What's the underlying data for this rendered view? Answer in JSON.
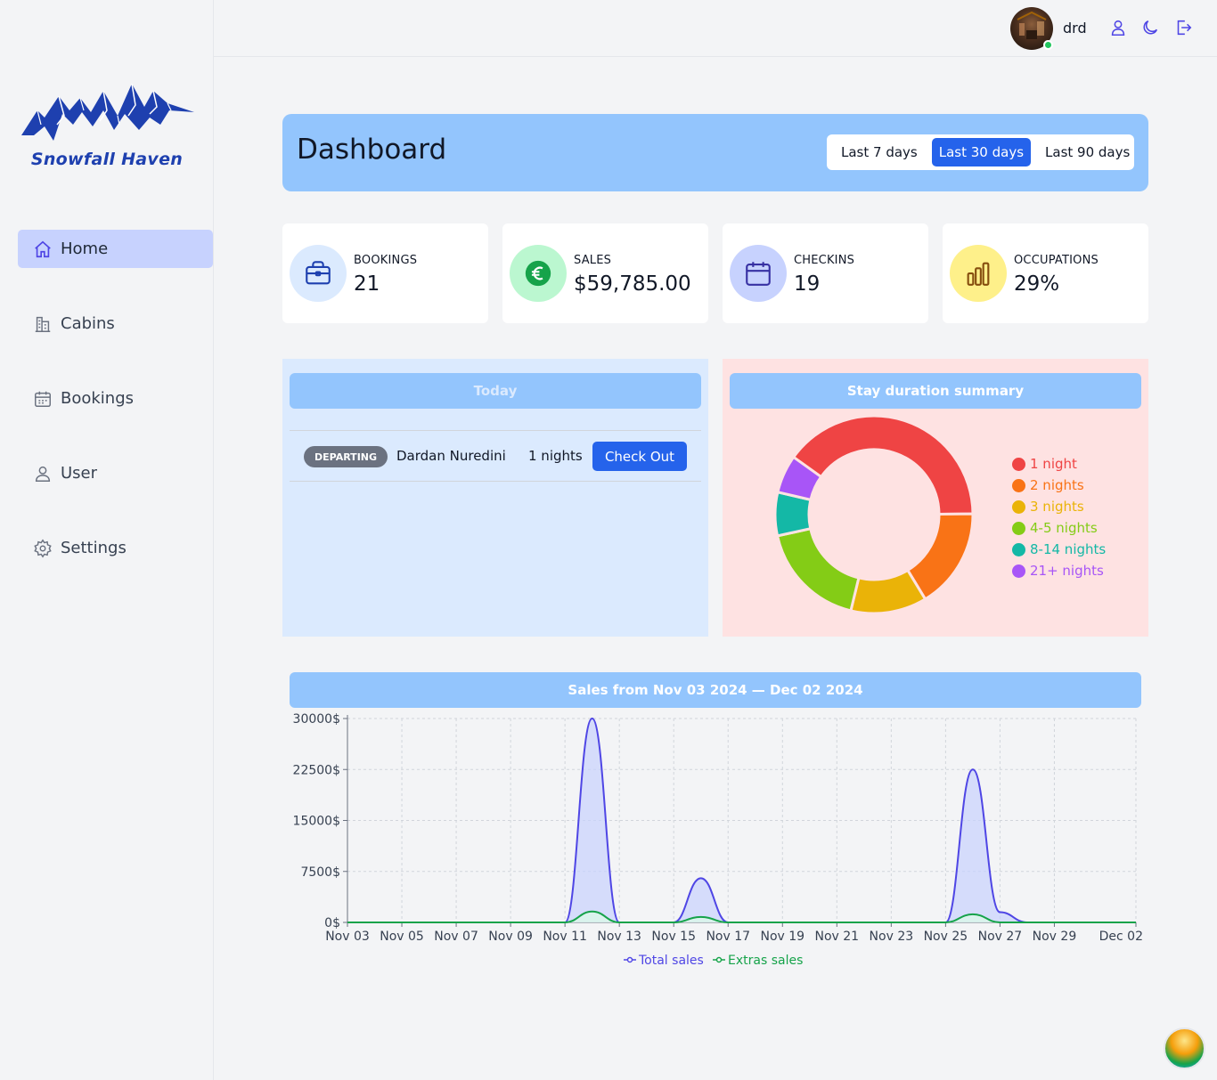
{
  "brand": {
    "name": "Snowfall Haven"
  },
  "sidebar": {
    "items": [
      {
        "label": "Home",
        "icon": "home-icon",
        "active": true
      },
      {
        "label": "Cabins",
        "icon": "building-icon",
        "active": false
      },
      {
        "label": "Bookings",
        "icon": "calendar-icon",
        "active": false
      },
      {
        "label": "User",
        "icon": "user-icon",
        "active": false
      },
      {
        "label": "Settings",
        "icon": "gear-icon",
        "active": false
      }
    ]
  },
  "header": {
    "username": "drd",
    "online": true,
    "actions": [
      "account-icon",
      "dark-mode-icon",
      "logout-icon"
    ]
  },
  "dashboard": {
    "title": "Dashboard",
    "filters": [
      "Last 7 days",
      "Last 30 days",
      "Last 90 days"
    ],
    "active_filter": "Last 30 days"
  },
  "stats": [
    {
      "label": "BOOKINGS",
      "value": "21",
      "icon": "briefcase-icon",
      "color": "#dbeafe"
    },
    {
      "label": "SALES",
      "value": "$59,785.00",
      "icon": "euro-icon",
      "color": "#bbf7d0"
    },
    {
      "label": "CHECKINS",
      "value": "19",
      "icon": "calendar-icon",
      "color": "#c7d2fe"
    },
    {
      "label": "OCCUPATIONS",
      "value": "29%",
      "icon": "bar-chart-icon",
      "color": "#fef08a"
    }
  ],
  "today": {
    "title": "Today",
    "activities": [
      {
        "status": "DEPARTING",
        "guest": "Dardan Nuredini",
        "nights": "1 nights",
        "action": "Check Out"
      }
    ]
  },
  "stay_duration": {
    "title": "Stay duration summary",
    "chart_data": {
      "type": "pie",
      "donut": true,
      "legend_position": "right",
      "slices": [
        {
          "label": "1 night",
          "value": 9,
          "color": "#ef4444"
        },
        {
          "label": "2 nights",
          "value": 3.7,
          "color": "#f97316"
        },
        {
          "label": "3 nights",
          "value": 2.8,
          "color": "#eab308"
        },
        {
          "label": "4-5 nights",
          "value": 4,
          "color": "#84cc16"
        },
        {
          "label": "8-14 nights",
          "value": 1.6,
          "color": "#14b8a6"
        },
        {
          "label": "21+ nights",
          "value": 1.4,
          "color": "#a855f7"
        }
      ]
    }
  },
  "sales": {
    "title": "Sales from Nov 03 2024 — Dec 02 2024",
    "chart_data": {
      "type": "area",
      "xlabel": "",
      "ylabel": "",
      "ylim": [
        0,
        30000
      ],
      "y_ticks": [
        "30000$",
        "22500$",
        "15000$",
        "7500$",
        "0$"
      ],
      "y_tick_values": [
        30000,
        22500,
        15000,
        7500,
        0
      ],
      "x_ticks": [
        "Nov 03",
        "Nov 05",
        "Nov 07",
        "Nov 09",
        "Nov 11",
        "Nov 13",
        "Nov 15",
        "Nov 17",
        "Nov 19",
        "Nov 21",
        "Nov 23",
        "Nov 25",
        "Nov 27",
        "Nov 29",
        "Dec 02"
      ],
      "x_tick_index": [
        0,
        2,
        4,
        6,
        8,
        10,
        12,
        14,
        16,
        18,
        20,
        22,
        24,
        26,
        29
      ],
      "grid": true,
      "legend_position": "bottom",
      "categories": [
        "Nov 03",
        "Nov 04",
        "Nov 05",
        "Nov 06",
        "Nov 07",
        "Nov 08",
        "Nov 09",
        "Nov 10",
        "Nov 11",
        "Nov 12",
        "Nov 13",
        "Nov 14",
        "Nov 15",
        "Nov 16",
        "Nov 17",
        "Nov 18",
        "Nov 19",
        "Nov 20",
        "Nov 21",
        "Nov 22",
        "Nov 23",
        "Nov 24",
        "Nov 25",
        "Nov 26",
        "Nov 27",
        "Nov 28",
        "Nov 29",
        "Nov 30",
        "Dec 01",
        "Dec 02"
      ],
      "series": [
        {
          "name": "Total sales",
          "color": "#4f46e5",
          "fill": "#c7d2fe",
          "values": [
            0,
            0,
            0,
            0,
            0,
            0,
            0,
            0,
            0,
            30000,
            0,
            0,
            0,
            6500,
            0,
            0,
            0,
            0,
            0,
            0,
            0,
            0,
            0,
            22500,
            1500,
            0,
            0,
            0,
            0,
            0
          ]
        },
        {
          "name": "Extras sales",
          "color": "#16a34a",
          "fill": "#dcfce7",
          "values": [
            0,
            0,
            0,
            0,
            0,
            0,
            0,
            0,
            0,
            1600,
            0,
            0,
            0,
            800,
            0,
            0,
            0,
            0,
            0,
            0,
            0,
            0,
            0,
            1200,
            0,
            0,
            0,
            0,
            0,
            0
          ]
        }
      ]
    }
  }
}
